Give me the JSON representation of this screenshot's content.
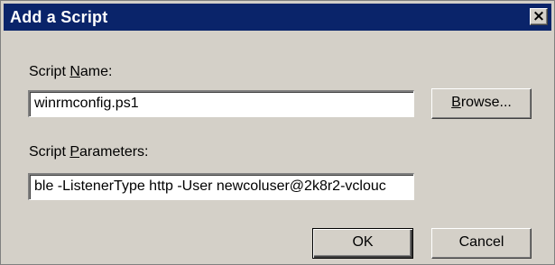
{
  "window": {
    "title": "Add a Script",
    "close_glyph": "×"
  },
  "script_name": {
    "label_before": "Script ",
    "label_access": "N",
    "label_after": "ame:",
    "value": "winrmconfig.ps1"
  },
  "script_parameters": {
    "label_before": "Script ",
    "label_access": "P",
    "label_after": "arameters:",
    "value": "ble -ListenerType http -User newcoluser@2k8r2-vclouc"
  },
  "buttons": {
    "browse": {
      "access": "B",
      "rest": "rowse..."
    },
    "ok": "OK",
    "cancel": "Cancel"
  },
  "colors": {
    "titlebar": "#0a246a",
    "face": "#d4d0c8"
  }
}
